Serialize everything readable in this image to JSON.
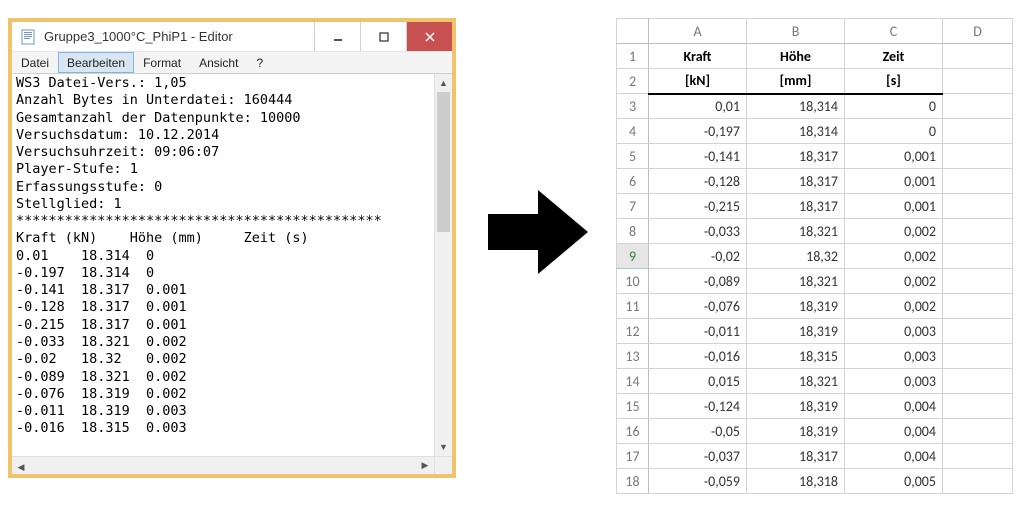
{
  "notepad": {
    "title": "Gruppe3_1000°C_PhiP1 - Editor",
    "menu": {
      "datei": "Datei",
      "bearbeiten": "Bearbeiten",
      "format": "Format",
      "ansicht": "Ansicht",
      "hilfe": "?"
    },
    "lines": {
      "l0": "WS3 Datei-Vers.: 1,05",
      "l1": "Anzahl Bytes in Unterdatei: 160444",
      "l2": "Gesamtanzahl der Datenpunkte: 10000",
      "l3": "Versuchsdatum: 10.12.2014",
      "l4": "Versuchsuhrzeit: 09:06:07",
      "l5": "Player-Stufe: 1",
      "l6": "Erfassungsstufe: 0",
      "l7": "Stellglied: 1",
      "l8": "*********************************************",
      "l9": "Kraft (kN)    Höhe (mm)     Zeit (s)",
      "l10": "0.01    18.314  0",
      "l11": "-0.197  18.314  0",
      "l12": "-0.141  18.317  0.001",
      "l13": "-0.128  18.317  0.001",
      "l14": "-0.215  18.317  0.001",
      "l15": "-0.033  18.321  0.002",
      "l16": "-0.02   18.32   0.002",
      "l17": "-0.089  18.321  0.002",
      "l18": "-0.076  18.319  0.002",
      "l19": "-0.011  18.319  0.003",
      "l20": "-0.016  18.315  0.003"
    }
  },
  "sheet": {
    "col_labels": {
      "A": "A",
      "B": "B",
      "C": "C",
      "D": "D"
    },
    "headers": {
      "kraft": "Kraft",
      "hoehe": "Höhe",
      "zeit": "Zeit"
    },
    "units": {
      "kraft": "[kN]",
      "hoehe": "[mm]",
      "zeit": "[s]"
    },
    "row_nums": {
      "r1": "1",
      "r2": "2",
      "r3": "3",
      "r4": "4",
      "r5": "5",
      "r6": "6",
      "r7": "7",
      "r8": "8",
      "r9": "9",
      "r10": "10",
      "r11": "11",
      "r12": "12",
      "r13": "13",
      "r14": "14",
      "r15": "15",
      "r16": "16",
      "r17": "17",
      "r18": "18"
    },
    "rows": {
      "r3": {
        "a": "0,01",
        "b": "18,314",
        "c": "0"
      },
      "r4": {
        "a": "-0,197",
        "b": "18,314",
        "c": "0"
      },
      "r5": {
        "a": "-0,141",
        "b": "18,317",
        "c": "0,001"
      },
      "r6": {
        "a": "-0,128",
        "b": "18,317",
        "c": "0,001"
      },
      "r7": {
        "a": "-0,215",
        "b": "18,317",
        "c": "0,001"
      },
      "r8": {
        "a": "-0,033",
        "b": "18,321",
        "c": "0,002"
      },
      "r9": {
        "a": "-0,02",
        "b": "18,32",
        "c": "0,002"
      },
      "r10": {
        "a": "-0,089",
        "b": "18,321",
        "c": "0,002"
      },
      "r11": {
        "a": "-0,076",
        "b": "18,319",
        "c": "0,002"
      },
      "r12": {
        "a": "-0,011",
        "b": "18,319",
        "c": "0,003"
      },
      "r13": {
        "a": "-0,016",
        "b": "18,315",
        "c": "0,003"
      },
      "r14": {
        "a": "0,015",
        "b": "18,321",
        "c": "0,003"
      },
      "r15": {
        "a": "-0,124",
        "b": "18,319",
        "c": "0,004"
      },
      "r16": {
        "a": "-0,05",
        "b": "18,319",
        "c": "0,004"
      },
      "r17": {
        "a": "-0,037",
        "b": "18,317",
        "c": "0,004"
      },
      "r18": {
        "a": "-0,059",
        "b": "18,318",
        "c": "0,005"
      }
    }
  },
  "chart_data": {
    "type": "table",
    "title": "",
    "columns": [
      "Kraft [kN]",
      "Höhe [mm]",
      "Zeit [s]"
    ],
    "rows": [
      [
        0.01,
        18.314,
        0
      ],
      [
        -0.197,
        18.314,
        0
      ],
      [
        -0.141,
        18.317,
        0.001
      ],
      [
        -0.128,
        18.317,
        0.001
      ],
      [
        -0.215,
        18.317,
        0.001
      ],
      [
        -0.033,
        18.321,
        0.002
      ],
      [
        -0.02,
        18.32,
        0.002
      ],
      [
        -0.089,
        18.321,
        0.002
      ],
      [
        -0.076,
        18.319,
        0.002
      ],
      [
        -0.011,
        18.319,
        0.003
      ],
      [
        -0.016,
        18.315,
        0.003
      ],
      [
        0.015,
        18.321,
        0.003
      ],
      [
        -0.124,
        18.319,
        0.004
      ],
      [
        -0.05,
        18.319,
        0.004
      ],
      [
        -0.037,
        18.317,
        0.004
      ],
      [
        -0.059,
        18.318,
        0.005
      ]
    ]
  }
}
